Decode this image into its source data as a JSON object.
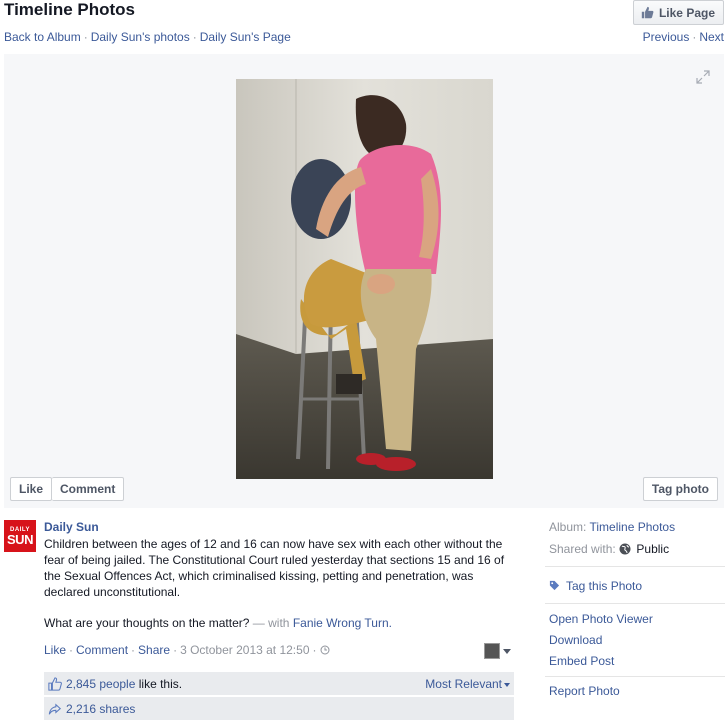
{
  "header": {
    "title": "Timeline Photos",
    "like_page": "Like Page",
    "nav": {
      "back": "Back to Album",
      "photos": "Daily Sun's photos",
      "page": "Daily Sun's Page",
      "sep": "·",
      "previous": "Previous",
      "next": "Next"
    }
  },
  "stage": {
    "like": "Like",
    "comment": "Comment",
    "tag_photo": "Tag photo"
  },
  "post": {
    "logo_small": "DAILY",
    "logo_big": "SUN",
    "author": "Daily Sun",
    "text": "Children between the ages of 12 and 16 can now have sex with each other without the fear of being jailed. The Constitutional Court ruled yesterday that sections 15 and 16 of the Sexual Offences Act, which criminalised kissing, petting and penetration, was declared unconstitutional.",
    "question": "What are your thoughts on the matter?",
    "with": "— with",
    "tagged": "Fanie Wrong Turn.",
    "actions": {
      "like": "Like",
      "comment": "Comment",
      "share": "Share"
    },
    "date": "3 October 2013 at 12:50",
    "likes_count": "2,845 people",
    "likes_suffix": "like this.",
    "sort": "Most Relevant",
    "shares": "2,216 shares"
  },
  "side": {
    "album_label": "Album:",
    "album_value": "Timeline Photos",
    "shared_label": "Shared with:",
    "shared_value": "Public",
    "tag": "Tag this Photo",
    "open_viewer": "Open Photo Viewer",
    "download": "Download",
    "embed": "Embed Post",
    "report": "Report Photo"
  },
  "colors": {
    "link": "#3b5998",
    "brand_red": "#d7131a",
    "stage_bg": "#f6f7f9"
  }
}
